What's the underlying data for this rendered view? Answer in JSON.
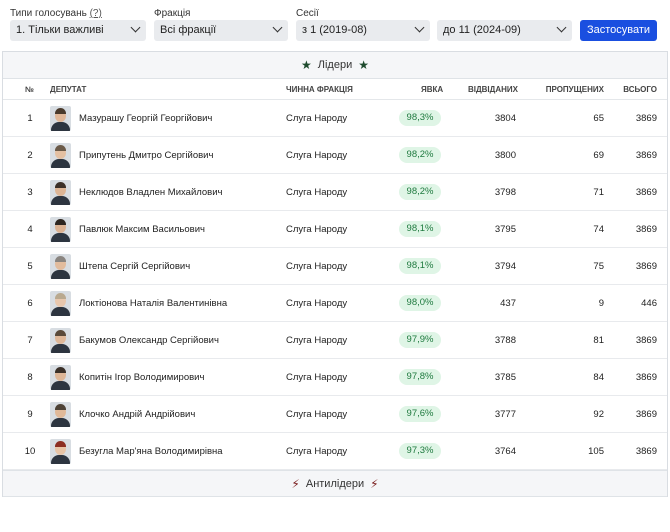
{
  "filters": {
    "types_label": "Типи голосувань",
    "types_help": "(?)",
    "types_value": "1. Тільки важливі",
    "faction_label": "Фракція",
    "faction_value": "Всі фракції",
    "sessions_label": "Сесії",
    "from_value": "з 1 (2019-08)",
    "to_value": "до 11 (2024-09)",
    "apply_label": "Застосувати"
  },
  "leaders": {
    "title": "Лідери",
    "columns": {
      "num": "№",
      "deputy": "ДЕПУТАТ",
      "faction": "ЧИННА ФРАКЦІЯ",
      "attendance": "ЯВКА",
      "attended": "ВІДВІДАНИХ",
      "missed": "ПРОПУЩЕНИХ",
      "total": "ВСЬОГО"
    },
    "rows": [
      {
        "num": "1",
        "name": "Мазурашу Георгій Георгійович",
        "faction": "Слуга Народу",
        "pct": "98,3%",
        "attended": "3804",
        "missed": "65",
        "total": "3869",
        "hair": "#4a3a2c",
        "face": "#e0b798"
      },
      {
        "num": "2",
        "name": "Припутень Дмитро Сергійович",
        "faction": "Слуга Народу",
        "pct": "98,2%",
        "attended": "3800",
        "missed": "69",
        "total": "3869",
        "hair": "#6b5a48",
        "face": "#e4c0a2"
      },
      {
        "num": "3",
        "name": "Неклюдов Владлен Михайлович",
        "faction": "Слуга Народу",
        "pct": "98,2%",
        "attended": "3798",
        "missed": "71",
        "total": "3869",
        "hair": "#3c3028",
        "face": "#ddb595"
      },
      {
        "num": "4",
        "name": "Павлюк Максим Васильович",
        "faction": "Слуга Народу",
        "pct": "98,1%",
        "attended": "3795",
        "missed": "74",
        "total": "3869",
        "hair": "#2e2620",
        "face": "#dcb292"
      },
      {
        "num": "5",
        "name": "Штепа Сергій Сергійович",
        "faction": "Слуга Народу",
        "pct": "98,1%",
        "attended": "3794",
        "missed": "75",
        "total": "3869",
        "hair": "#8a8580",
        "face": "#e2bc9d"
      },
      {
        "num": "6",
        "name": "Локтіонова Наталія Валентинівна",
        "faction": "Слуга Народу",
        "pct": "98,0%",
        "attended": "437",
        "missed": "9",
        "total": "446",
        "hair": "#b9a98f",
        "face": "#e8c7ad"
      },
      {
        "num": "7",
        "name": "Бакумов Олександр Сергійович",
        "faction": "Слуга Народу",
        "pct": "97,9%",
        "attended": "3788",
        "missed": "81",
        "total": "3869",
        "hair": "#5a4a3a",
        "face": "#dfb899"
      },
      {
        "num": "8",
        "name": "Копитін Ігор Володимирович",
        "faction": "Слуга Народу",
        "pct": "97,8%",
        "attended": "3785",
        "missed": "84",
        "total": "3869",
        "hair": "#3a3028",
        "face": "#ddb697"
      },
      {
        "num": "9",
        "name": "Клочко Андрій Андрійович",
        "faction": "Слуга Народу",
        "pct": "97,6%",
        "attended": "3777",
        "missed": "92",
        "total": "3869",
        "hair": "#4e4236",
        "face": "#e0b999"
      },
      {
        "num": "10",
        "name": "Безугла Мар'яна Володимирівна",
        "faction": "Слуга Народу",
        "pct": "97,3%",
        "attended": "3764",
        "missed": "105",
        "total": "3869",
        "hair": "#8c2e22",
        "face": "#e8c4a6"
      }
    ]
  },
  "antileaders": {
    "title": "Антилідери"
  },
  "colors": {
    "accent": "#1a4fe0",
    "pct_bg": "#dff5e6",
    "pct_text": "#1f7a3f",
    "leader_icon": "#1e4b2e",
    "antileader_icon": "#7a1d1d"
  }
}
